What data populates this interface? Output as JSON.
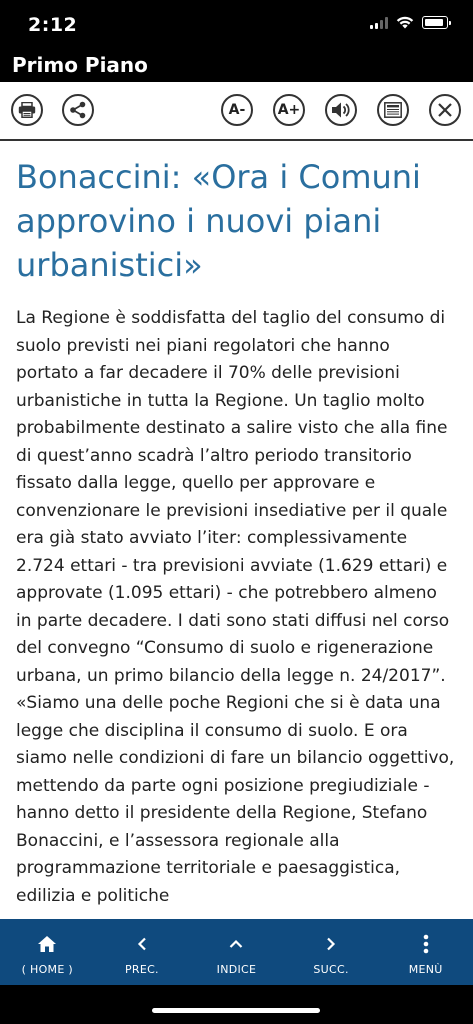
{
  "status": {
    "time": "2:12"
  },
  "titlebar": {
    "title": "Primo Piano"
  },
  "toolbar": {
    "font_decrease": "A-",
    "font_increase": "A+"
  },
  "article": {
    "headline": "Bonaccini: «Ora i Comuni approvino i nuovi piani urbanistici»",
    "body": "La Regione è soddisfatta del taglio del consumo di suolo previsti nei piani regolatori che hanno portato a far decadere il 70% delle previsioni urbanistiche in tutta la Regione. Un taglio molto probabilmente destinato a salire visto che alla fine di quest’anno scadrà l’altro periodo transitorio fissato dalla legge, quello per approvare e convenzionare le previsioni insediative per il quale era già stato avviato l’iter: complessivamente 2.724 ettari - tra previsioni avviate (1.629 ettari) e approvate (1.095 ettari) - che potrebbero almeno in parte decadere. I dati sono stati diffusi nel corso del convegno “Consumo di suolo e rigenerazione urbana, un primo bilancio della legge n. 24/2017”. «Siamo una delle poche Regioni che si è data una legge che disciplina il consumo di suolo. E ora siamo nelle condizioni di fare un bilancio oggettivo, mettendo da parte ogni posizione pregiudiziale - hanno detto il presidente della Regione, Stefano Bonaccini, e l’assessora regionale alla programmazione territoriale e paesaggistica, edilizia e politiche"
  },
  "bottomnav": {
    "home": "( HOME )",
    "prev": "PREC.",
    "index": "INDICE",
    "next": "SUCC.",
    "menu": "MENÙ"
  },
  "colors": {
    "headline": "#2a6f9f",
    "nav_bg": "#0f4a7e"
  }
}
